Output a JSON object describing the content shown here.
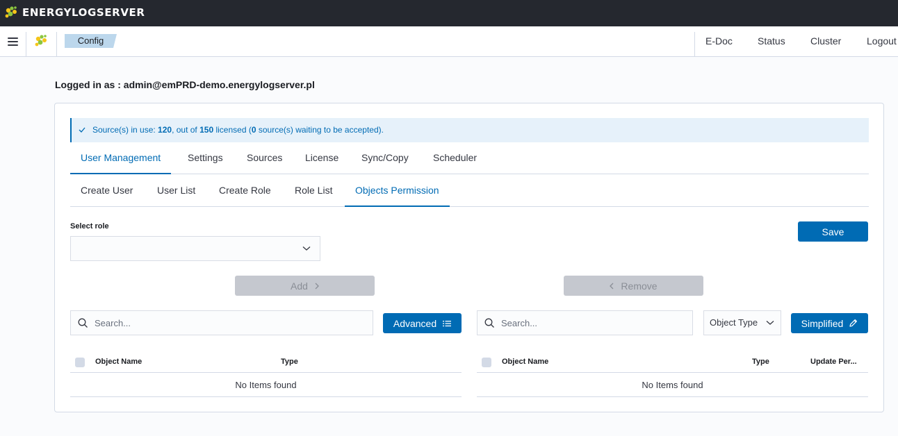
{
  "app": {
    "brand_name": "ENERGYLOGSERVER"
  },
  "header": {
    "breadcrumb": "Config",
    "nav": [
      "E-Doc",
      "Status",
      "Cluster",
      "Logout"
    ]
  },
  "logged_in": "Logged in as : admin@emPRD-demo.energylogserver.pl",
  "callout": {
    "prefix": "Source(s) in use: ",
    "in_use": "120",
    "middle": ", out of ",
    "licensed": "150",
    "middle2": " licensed (",
    "waiting": "0",
    "suffix": " source(s) waiting to be accepted)."
  },
  "main_tabs": {
    "user_management": "User Management",
    "settings": "Settings",
    "sources": "Sources",
    "license": "License",
    "sync_copy": "Sync/Copy",
    "scheduler": "Scheduler",
    "active": "User Management"
  },
  "sub_tabs": {
    "create_user": "Create User",
    "user_list": "User List",
    "create_role": "Create Role",
    "role_list": "Role List",
    "objects_permission": "Objects Permission",
    "active": "Objects Permission"
  },
  "form": {
    "select_role_label": "Select role",
    "select_role_value": "",
    "save_label": "Save",
    "add_label": "Add",
    "remove_label": "Remove"
  },
  "left": {
    "search_placeholder": "Search...",
    "advanced_label": "Advanced",
    "columns": {
      "object_name": "Object Name",
      "type": "Type"
    },
    "empty": "No Items found"
  },
  "right": {
    "search_placeholder": "Search...",
    "object_type_label": "Object Type",
    "simplified_label": "Simplified",
    "columns": {
      "object_name": "Object Name",
      "type": "Type",
      "update_permission": "Update Per..."
    },
    "empty": "No Items found"
  },
  "colors": {
    "primary": "#006bb4",
    "topbar": "#25282f",
    "callout_bg": "#e6f1fa",
    "breadcrumb_bg": "#bcd7ec",
    "disabled_bg": "#c5c8cf"
  },
  "icons": {
    "brand": "energylogserver-logo",
    "menu": "hamburger-menu-icon",
    "callout": "check-icon",
    "select": "chevron-down-icon",
    "add": "chevron-right-icon",
    "remove": "chevron-left-icon",
    "search": "search-icon",
    "advanced": "list-icon",
    "simplified": "pencil-icon"
  }
}
